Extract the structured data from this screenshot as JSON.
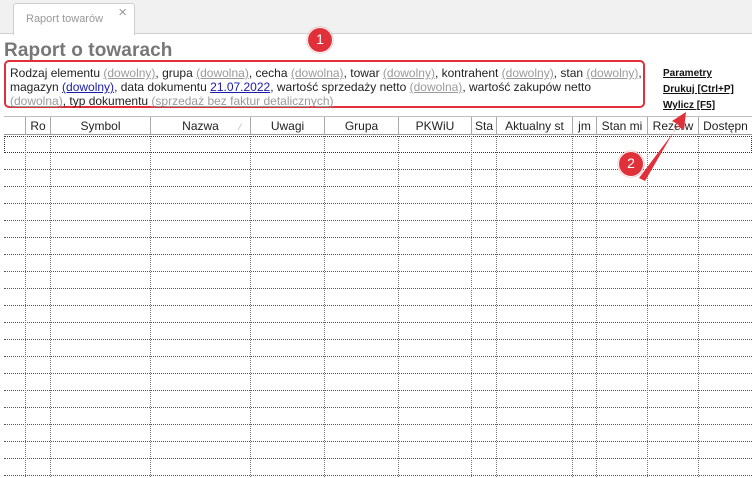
{
  "tab": {
    "title": "Raport towarów",
    "close": "×"
  },
  "page_title": "Raport o towarach",
  "filters": {
    "l1_a": "Rodzaj elementu ",
    "l1_b": "(dowolny)",
    "l1_c": ", grupa ",
    "l1_d": "(dowolna)",
    "l1_e": ", cecha ",
    "l1_f": "(dowolna)",
    "l1_g": ", towar ",
    "l1_h": "(dowolny)",
    "l1_i": ", kontrahent ",
    "l1_j": "(dowolny)",
    "l1_k": ", stan ",
    "l1_l": "(dowolny)",
    "l1_m": ",",
    "l2_a": "magazyn ",
    "l2_b": "(dowolny)",
    "l2_c": ", data dokumentu ",
    "l2_d": "21.07.2022",
    "l2_e": ", wartość sprzedaży netto ",
    "l2_f": "(dowolna)",
    "l2_g": ", wartość zakupów netto",
    "l3_a": "(dowolna)",
    "l3_b": ", typ dokumentu ",
    "l3_c": "(sprzedaż bez faktur detalicznych)"
  },
  "actions": {
    "params": "Parametry",
    "print": "Drukuj [Ctrl+P]",
    "compute": "Wylicz [F5]"
  },
  "annotations": {
    "badge1": "1",
    "badge2": "2",
    "color": "#e0313b"
  },
  "grid": {
    "columns": [
      "Ro",
      "Symbol",
      "Nazwa",
      "Uwagi",
      "Grupa",
      "PKWiU",
      "Sta",
      "Aktualny st",
      "jm",
      "Stan mi",
      "Rezerw",
      "Dostępn"
    ],
    "sort_mark": "⁄"
  }
}
